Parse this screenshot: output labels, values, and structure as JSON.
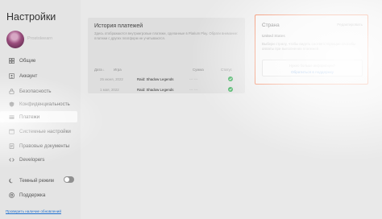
{
  "sidebar": {
    "title": "Настройки",
    "username": "Prostoleearn",
    "items": [
      {
        "label": "Общие",
        "icon": "grid-icon",
        "active": false
      },
      {
        "label": "Аккаунт",
        "icon": "account-icon",
        "active": false
      },
      {
        "label": "Безопасность",
        "icon": "lock-icon",
        "active": false
      },
      {
        "label": "Конфиденциальность",
        "icon": "shield-icon",
        "active": false
      },
      {
        "label": "Платежи",
        "icon": "card-icon",
        "active": true
      },
      {
        "label": "Системные настройки",
        "icon": "window-icon",
        "active": false
      },
      {
        "label": "Правовые документы",
        "icon": "document-icon",
        "active": false
      },
      {
        "label": "Developers",
        "icon": "code-icon",
        "active": false
      },
      {
        "label": "Темный режим",
        "icon": "moon-icon",
        "active": false
      },
      {
        "label": "Поддержка",
        "icon": "help-icon",
        "active": false
      }
    ],
    "update_link": "Проверить наличие обновлений"
  },
  "payments": {
    "title": "История платежей",
    "description": "Здесь отображаются внутриигровые платежи, сделанные в Plarium Play. Обрати внимание: платежи с других платформ не учитываются.",
    "columns": {
      "date": "Дата",
      "game": "Игра",
      "amount": "Сумма",
      "status": "Статус"
    },
    "rows": [
      {
        "date": "25 июня, 2022",
        "game": "Raid: Shadow Legends",
        "amount": "••• •••",
        "status": "ok"
      },
      {
        "date": "1 мая, 2022",
        "game": "Raid: Shadow Legends",
        "amount": "••• •••",
        "status": "ok"
      }
    ]
  },
  "country": {
    "title": "Страна",
    "edit": "Редактировать",
    "value": "United States",
    "description": "Выбери страну, чтобы видеть соответствующие способы оплаты при выполнении платежей.",
    "help_question": "Нужно больше информации?",
    "help_link": "Обратиться в поддержку"
  },
  "colors": {
    "accent": "#ee6a3a",
    "link": "#1e6fd0",
    "status_ok": "#2fa84f"
  }
}
